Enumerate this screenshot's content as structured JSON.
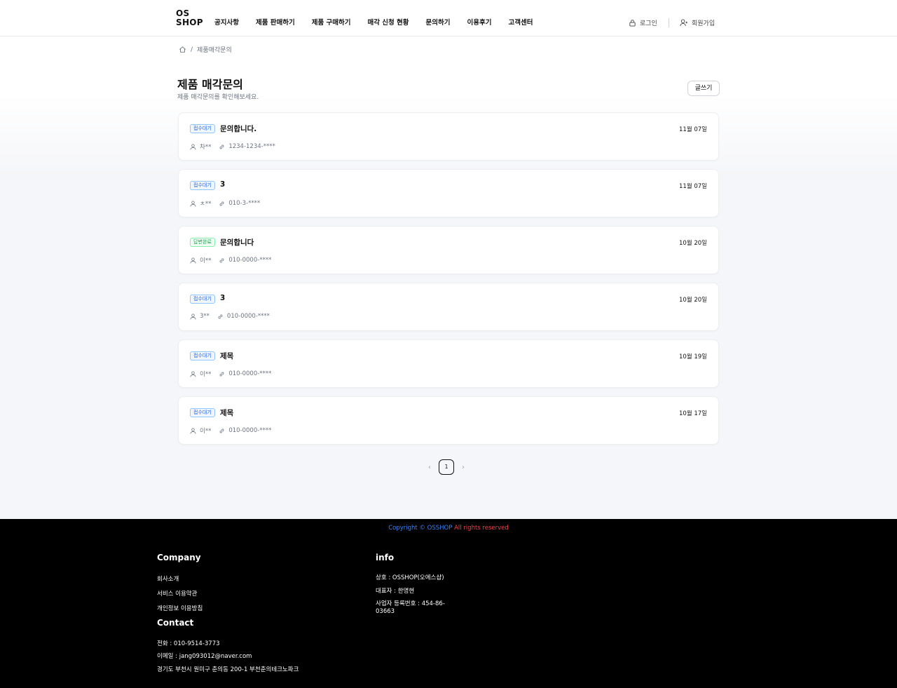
{
  "header": {
    "logo_line1": "OS",
    "logo_line2": "SHOP",
    "nav": [
      "공지사항",
      "제품 판매하기",
      "제품 구매하기",
      "매각 신청 현황",
      "문의하기",
      "이용후기",
      "고객센터"
    ],
    "login": "로그인",
    "signup": "회원가입"
  },
  "breadcrumb": {
    "sep": "/",
    "current": "제품매각문의"
  },
  "page": {
    "title": "제품 매각문의",
    "subtitle": "제품 매각문의를 확인해보세요.",
    "write_button": "글쓰기"
  },
  "inquiries": [
    {
      "status": "접수대기",
      "status_type": "wait",
      "title": "문의합니다.",
      "date": "11월 07일",
      "name": "차**",
      "phone": "1234-1234-****"
    },
    {
      "status": "접수대기",
      "status_type": "wait",
      "title": "3",
      "date": "11월 07일",
      "name": "ㅊ**",
      "phone": "010-3-****"
    },
    {
      "status": "답변완료",
      "status_type": "done",
      "title": "문의합니다",
      "date": "10월 20일",
      "name": "이**",
      "phone": "010-0000-****"
    },
    {
      "status": "접수대기",
      "status_type": "wait",
      "title": "3",
      "date": "10월 20일",
      "name": "3**",
      "phone": "010-0000-****"
    },
    {
      "status": "접수대기",
      "status_type": "wait",
      "title": "제목",
      "date": "10월 19일",
      "name": "이**",
      "phone": "010-0000-****"
    },
    {
      "status": "접수대기",
      "status_type": "wait",
      "title": "제목",
      "date": "10월 17일",
      "name": "이**",
      "phone": "010-0000-****"
    }
  ],
  "pagination": {
    "prev": "‹",
    "current": "1",
    "next": "›"
  },
  "footer": {
    "copyright_a": "Copyright © OSSHOP",
    "copyright_b": " All rights reserved",
    "company_heading": "Company",
    "company_links": [
      "회사소개",
      "서비스 이용약관",
      "개인정보 이용방침"
    ],
    "contact_heading": "Contact",
    "phone": "전화 : 010-9514-3773",
    "email": "이메일 : jang093012@naver.com",
    "address": "경기도 부천시 원미구 춘의동 200-1 부천춘의테크노파크",
    "info_heading": "info",
    "business_name": "상호 : OSSHOP(오에스샵)",
    "ceo": "대표자 : 한명현",
    "reg_line1": "사업자 등록번호 : 454-86-",
    "reg_line2": "03663"
  },
  "colors": {
    "badge_wait": "#2563eb",
    "badge_done": "#16a34a",
    "footer_bg": "#000000",
    "copyright_blue": "#3b82f6",
    "copyright_red": "#ef4444"
  },
  "icons": [
    "home-icon",
    "lock-icon",
    "user-add-icon",
    "user-icon",
    "link-icon",
    "chevron-left-icon",
    "chevron-right-icon"
  ]
}
